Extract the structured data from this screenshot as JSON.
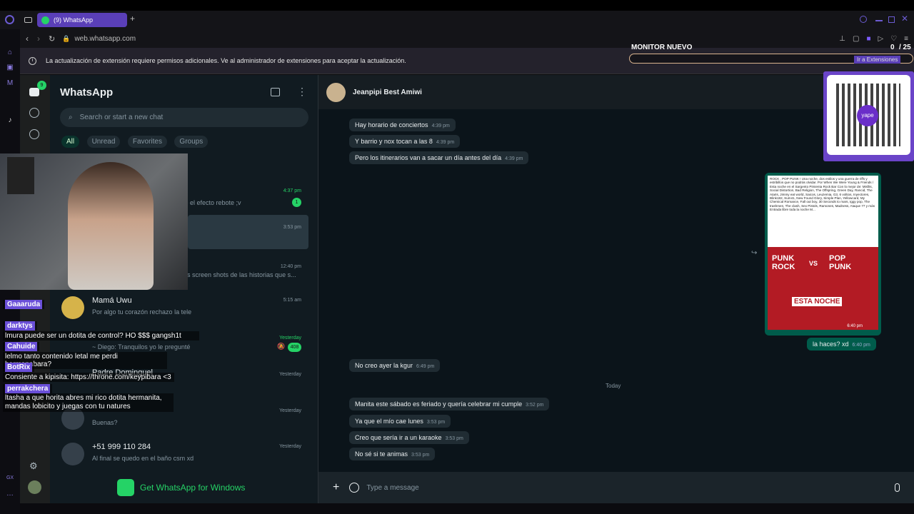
{
  "browser": {
    "tab_title": "(9) WhatsApp",
    "url": "web.whatsapp.com",
    "new_tab_symbol": "+"
  },
  "notice": {
    "text": "La actualización de extensión requiere permisos adicionales. Ve al administrador de extensiones para aceptar la actualización.",
    "button": "Ir a Extensiones"
  },
  "overlay": {
    "monitor_title": "MONITOR NUEVO",
    "monitor_count": "0",
    "monitor_total": "/ 25",
    "qr_caption": "yape"
  },
  "wa_rail": {
    "badge": "9"
  },
  "sidebar": {
    "title": "WhatsApp",
    "search_placeholder": "Search or start a new chat",
    "filters": [
      "All",
      "Unread",
      "Favorites",
      "Groups"
    ],
    "chats": [
      {
        "name": "",
        "preview": "te el efecto rebote ;v",
        "time": "4:37 pm",
        "badge": "1"
      },
      {
        "name": "",
        "preview": "",
        "time": "3:53 pm",
        "badge": ""
      },
      {
        "name": "",
        "preview": "s screen shots de las historias que s...",
        "time": "12:40 pm",
        "badge": ""
      },
      {
        "name": "Mamá Uwu",
        "preview": "Por algo tu corazón rechazo la tele",
        "time": "5:15 am",
        "badge": ""
      },
      {
        "name": "",
        "preview": "~ Diego: Tranquilos yo le pregunté",
        "time": "Yesterday",
        "badge": "408"
      },
      {
        "name": "Padre Dominguel",
        "preview": "",
        "time": "Yesterday",
        "badge": ""
      },
      {
        "name": "",
        "preview": "Buenas?",
        "time": "Yesterday",
        "badge": ""
      },
      {
        "name": "+51 999 110 284",
        "preview": "Al final se quedo en el baño csm xd",
        "time": "Yesterday",
        "badge": ""
      }
    ],
    "footer": "Get WhatsApp for Windows"
  },
  "stream_chat": [
    {
      "user": "Gaaaruda",
      "text": ""
    },
    {
      "user": "darktys",
      "text": "lmura puede ser un dotita de control? HO $$$ gangsh1t"
    },
    {
      "user": "Cahuide",
      "text": "lelmo tanto contenido letal me perdi hermanabara?"
    },
    {
      "user": "BotRix",
      "text": "Consiente a kipisita: https://throne.com/keypibara <3"
    },
    {
      "user": "perrakchera",
      "text": "ltasha a que horita abres mi rico dotita hermanita, mandas lobicito y juegas con tu natures"
    }
  ],
  "chat": {
    "contact": "Jeanpipi Best Amiwi",
    "messages_top": [
      {
        "text": "Hay horario de conciertos",
        "time": "4:39 pm"
      },
      {
        "text": "Y barrio y nox tocan a las 8",
        "time": "4:39 pm"
      },
      {
        "text": "Pero los itinerarios van a sacar un día antes del día",
        "time": "4:39 pm"
      }
    ],
    "poster_text": "ROCK , POP PUNK ! Una noche, dos estilos y una guerra de riffs y estribillos que no podrás olvidar. Por When We Were Young & Friends / Esta noche en el Sargento Pimienta Rock Bar Con lo mejor de: Misfits, Social Distortion, Bad Religion, The Offspring, Green Day, Rancid, The Ataris, Jimmy eat world, Saicos, Leuzemia, G3, 6 voltios, Inyectores, Blink182, Sum41, New Found Glory, Simple Plan, Yellowcard, My Chemical Romance, Fall out boy, 30 Seconds to mars, Iggy pop, The trashmen, The clash, Sex Pistols, Ramones, Madness, Ataque 77 y más Entrada libre toda la noche M...",
    "poster_title_left": "PUNK ROCK",
    "poster_vs": "VS",
    "poster_title_right": "POP PUNK",
    "poster_caption": "ESTA NOCHE",
    "poster_time": "6:40 pm",
    "out_message": {
      "text": "la haces? xd",
      "time": "6:40 pm"
    },
    "msg_single": {
      "text": "No creo ayer la kgur",
      "time": "6:49 pm"
    },
    "day_divider": "Today",
    "messages_bottom": [
      {
        "text": "Manita este sábado es feriado y quería celebrar mi cumple",
        "time": "3:52 pm"
      },
      {
        "text": "Ya que el mío cae lunes",
        "time": "3:53 pm"
      },
      {
        "text": "Creo que sería ir a un karaoke",
        "time": "3:53 pm"
      },
      {
        "text": "No sé si te animas",
        "time": "3:53 pm"
      }
    ],
    "composer_placeholder": "Type a message"
  },
  "colors": {
    "accent": "#25d366",
    "tab": "#5a3fb8",
    "bubble_in": "#202c33",
    "bubble_out": "#005c4b"
  }
}
